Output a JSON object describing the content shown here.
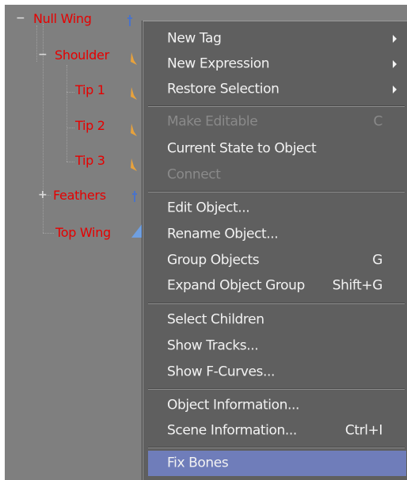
{
  "tree": {
    "nodes": [
      {
        "label": "Null Wing",
        "expander": "−"
      },
      {
        "label": "Shoulder",
        "expander": "−"
      },
      {
        "label": "Tip 1"
      },
      {
        "label": "Tip 2"
      },
      {
        "label": "Tip 3"
      },
      {
        "label": "Feathers",
        "expander": "+"
      },
      {
        "label": "Top Wing"
      }
    ]
  },
  "menu": {
    "items": [
      {
        "label": "New Tag",
        "submenu": true
      },
      {
        "label": "New Expression",
        "submenu": true
      },
      {
        "label": "Restore Selection",
        "submenu": true
      },
      {
        "label": "Make Editable",
        "shortcut": "C",
        "disabled": true
      },
      {
        "label": "Current State to Object"
      },
      {
        "label": "Connect",
        "disabled": true
      },
      {
        "label": "Edit Object..."
      },
      {
        "label": "Rename Object..."
      },
      {
        "label": "Group Objects",
        "shortcut": "G"
      },
      {
        "label": "Expand Object Group",
        "shortcut": "Shift+G"
      },
      {
        "label": "Select Children"
      },
      {
        "label": "Show Tracks..."
      },
      {
        "label": "Show F-Curves..."
      },
      {
        "label": "Object Information..."
      },
      {
        "label": "Scene Information...",
        "shortcut": "Ctrl+I"
      },
      {
        "label": "Fix Bones",
        "highlighted": true
      }
    ]
  },
  "colors": {
    "background": "#7f7f7f",
    "menu_background": "#5f5f5f",
    "object_label": "#e60000",
    "highlight": "#6f7dba",
    "bone_icon": "#e8a23c"
  },
  "icons": [
    "bone-icon",
    "null-icon",
    "polygon-icon",
    "submenu-arrow-icon"
  ]
}
